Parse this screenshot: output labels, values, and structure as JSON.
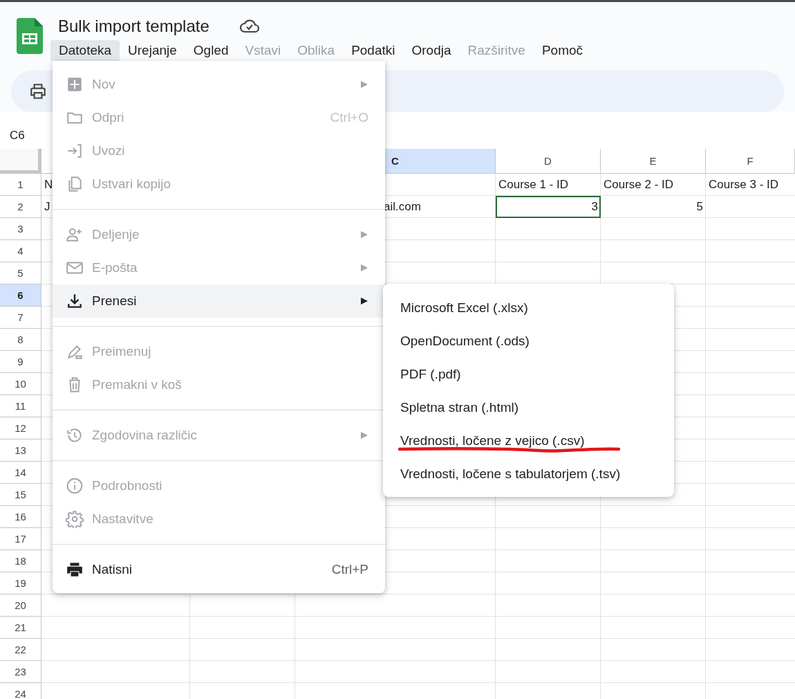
{
  "document": {
    "title": "Bulk import template"
  },
  "menubar": [
    {
      "label": "Datoteka",
      "selected": true,
      "disabled": false
    },
    {
      "label": "Urejanje",
      "selected": false,
      "disabled": false
    },
    {
      "label": "Ogled",
      "selected": false,
      "disabled": false
    },
    {
      "label": "Vstavi",
      "selected": false,
      "disabled": true
    },
    {
      "label": "Oblika",
      "selected": false,
      "disabled": true
    },
    {
      "label": "Podatki",
      "selected": false,
      "disabled": false
    },
    {
      "label": "Orodja",
      "selected": false,
      "disabled": false
    },
    {
      "label": "Razširitve",
      "selected": false,
      "disabled": true
    },
    {
      "label": "Pomoč",
      "selected": false,
      "disabled": false
    }
  ],
  "name_box": "C6",
  "sheet": {
    "columns": [
      {
        "label": "C",
        "selected": true
      },
      {
        "label": "D",
        "selected": false
      },
      {
        "label": "E",
        "selected": false
      },
      {
        "label": "F",
        "selected": false
      }
    ],
    "rows": [
      {
        "label": "1",
        "selected": false,
        "cells": [
          {
            "text": "N",
            "kind": "text",
            "outlined": false
          },
          null,
          null,
          {
            "text": "Course 1 - ID",
            "kind": "text",
            "outlined": false
          },
          {
            "text": "Course 2 - ID",
            "kind": "text",
            "outlined": false
          },
          {
            "text": "Course 3 - ID",
            "kind": "text",
            "outlined": false
          }
        ]
      },
      {
        "label": "2",
        "selected": false,
        "cells": [
          {
            "text": "J",
            "kind": "text",
            "outlined": false
          },
          null,
          {
            "text": "ail.com",
            "kind": "clipped",
            "outlined": false
          },
          {
            "text": "3",
            "kind": "number",
            "outlined": true
          },
          {
            "text": "5",
            "kind": "number",
            "outlined": false
          },
          null
        ]
      },
      {
        "label": "3",
        "selected": false
      },
      {
        "label": "4",
        "selected": false
      },
      {
        "label": "5",
        "selected": false
      },
      {
        "label": "6",
        "selected": true
      },
      {
        "label": "7",
        "selected": false
      },
      {
        "label": "8",
        "selected": false
      },
      {
        "label": "9",
        "selected": false
      },
      {
        "label": "10",
        "selected": false
      },
      {
        "label": "11",
        "selected": false
      },
      {
        "label": "12",
        "selected": false
      },
      {
        "label": "13",
        "selected": false
      },
      {
        "label": "14",
        "selected": false
      },
      {
        "label": "15",
        "selected": false
      },
      {
        "label": "16",
        "selected": false
      },
      {
        "label": "17",
        "selected": false
      },
      {
        "label": "18",
        "selected": false
      },
      {
        "label": "19",
        "selected": false
      },
      {
        "label": "20",
        "selected": false
      },
      {
        "label": "21",
        "selected": false
      },
      {
        "label": "22",
        "selected": false
      },
      {
        "label": "23",
        "selected": false
      },
      {
        "label": "24",
        "selected": false
      }
    ]
  },
  "file_menu": {
    "groups": [
      {
        "items": [
          {
            "label": "Nov",
            "disabled": true,
            "selected": false,
            "submenu": true
          },
          {
            "label": "Odpri",
            "disabled": true,
            "selected": false,
            "submenu": false,
            "shortcut": "Ctrl+O"
          },
          {
            "label": "Uvozi",
            "disabled": true,
            "selected": false,
            "submenu": false
          },
          {
            "label": "Ustvari kopijo",
            "disabled": true,
            "selected": false,
            "submenu": false
          }
        ]
      },
      {
        "items": [
          {
            "label": "Deljenje",
            "disabled": true,
            "selected": false,
            "submenu": true
          },
          {
            "label": "E-pošta",
            "disabled": true,
            "selected": false,
            "submenu": true
          },
          {
            "label": "Prenesi",
            "disabled": false,
            "selected": true,
            "submenu": true
          }
        ]
      },
      {
        "items": [
          {
            "label": "Preimenuj",
            "disabled": true,
            "selected": false,
            "submenu": false
          },
          {
            "label": "Premakni v koš",
            "disabled": true,
            "selected": false,
            "submenu": false
          }
        ]
      },
      {
        "items": [
          {
            "label": "Zgodovina različic",
            "disabled": true,
            "selected": false,
            "submenu": true
          }
        ]
      },
      {
        "items": [
          {
            "label": "Podrobnosti",
            "disabled": true,
            "selected": false,
            "submenu": false
          },
          {
            "label": "Nastavitve",
            "disabled": true,
            "selected": false,
            "submenu": false
          }
        ]
      },
      {
        "items": [
          {
            "label": "Natisni",
            "disabled": false,
            "selected": false,
            "submenu": false,
            "shortcut": "Ctrl+P"
          }
        ]
      }
    ]
  },
  "download_submenu": {
    "items": [
      {
        "label": "Microsoft Excel (.xlsx)",
        "underlined": false
      },
      {
        "label": "OpenDocument (.ods)",
        "underlined": false
      },
      {
        "label": "PDF (.pdf)",
        "underlined": false
      },
      {
        "label": "Spletna stran (.html)",
        "underlined": false
      },
      {
        "label": "Vrednosti, ločene z vejico (.csv)",
        "underlined": true
      },
      {
        "label": "Vrednosti, ločene s tabulatorjem (.tsv)",
        "underlined": false
      }
    ]
  }
}
